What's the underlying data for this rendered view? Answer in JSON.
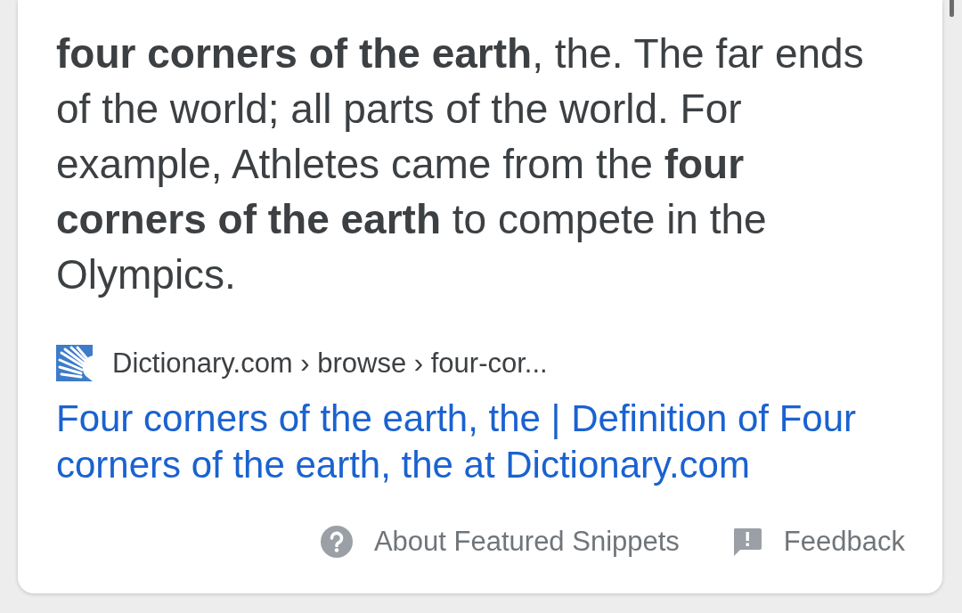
{
  "definition": {
    "text": "**four corners of the earth**, the. The far ends of the world; all parts of the world. For example, Athletes came from the **four corners of the earth** to compete in the Olympics."
  },
  "source": {
    "path": "Dictionary.com › browse › four-cor..."
  },
  "result_title": "Four corners of the earth, the | Definition of Four corners of the earth, the at Dictionary.com",
  "footer_links": [
    {
      "kind": "help",
      "label": "About Featured Snippets"
    },
    {
      "kind": "feedback",
      "label": "Feedback"
    }
  ]
}
